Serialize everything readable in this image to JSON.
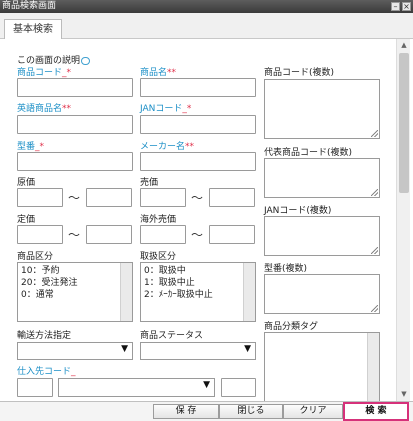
{
  "window": {
    "title": "商品検索画面",
    "minimize": "–",
    "close": "×"
  },
  "tabs": [
    {
      "label": "基本検索"
    }
  ],
  "help": {
    "text": "この画面の説明"
  },
  "fields": {
    "product_code": "商品コード",
    "product_name": "商品名",
    "english_name": "英語商品名",
    "jan_code": "JANコード",
    "model_no": "型番",
    "maker_name": "メーカー名",
    "cost": "原価",
    "selling_price": "売価",
    "list_price": "定価",
    "overseas_price": "海外売価",
    "product_category": "商品区分",
    "handling_category": "取扱区分",
    "shipping_method": "輸送方法指定",
    "product_status": "商品ステータス",
    "supplier_code": "仕入先コード"
  },
  "req_marks": {
    "underscore_star": "_*",
    "stars": "**",
    "underscore": "_"
  },
  "range_sep": "〜",
  "product_category_options": [
    "10：予約",
    "20：受注発注",
    "0：通常"
  ],
  "handling_category_options": [
    "0：取扱中",
    "1：取扱中止",
    "2：ﾒｰｶｰ取扱中止"
  ],
  "right_fields": {
    "product_codes_multi": "商品コード(複数)",
    "rep_codes_multi": "代表商品コード(複数)",
    "jan_multi": "JANコード(複数)",
    "model_multi": "型番(複数)",
    "category_tag": "商品分類タグ"
  },
  "footer": {
    "save": "保 存",
    "close": "閉じる",
    "clear": "クリア",
    "search": "検 索"
  }
}
